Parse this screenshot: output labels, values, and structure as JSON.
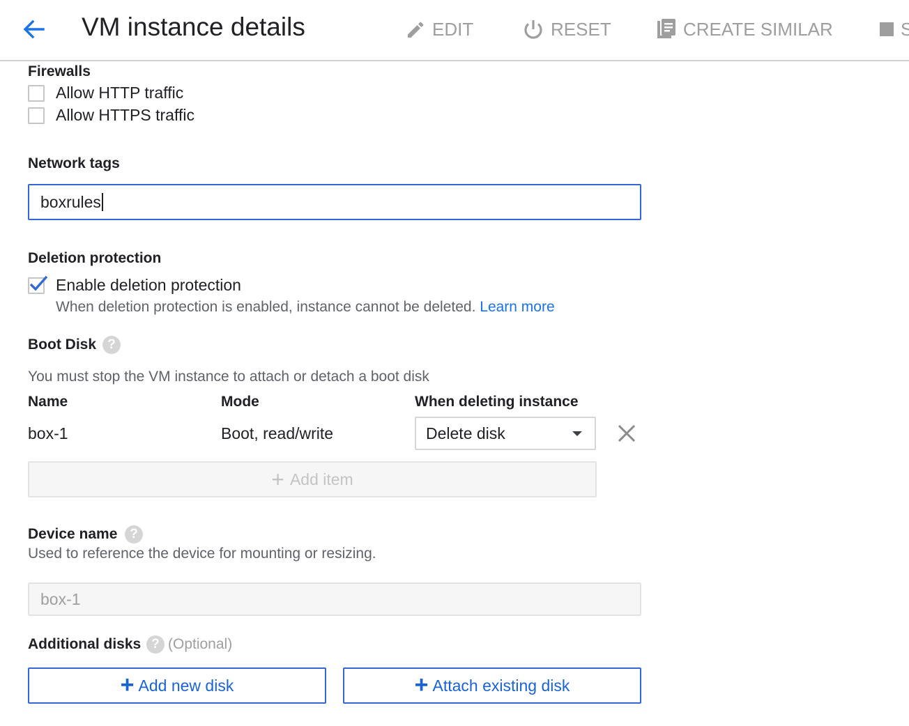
{
  "header": {
    "title": "VM instance details",
    "actions": [
      {
        "label": "EDIT",
        "icon": "pencil-icon"
      },
      {
        "label": "RESET",
        "icon": "power-icon"
      },
      {
        "label": "CREATE SIMILAR",
        "icon": "clipboard-copy-icon"
      },
      {
        "label": "S",
        "icon": "stop-icon"
      }
    ]
  },
  "firewalls": {
    "title": "Firewalls",
    "options": [
      {
        "label": "Allow HTTP traffic",
        "checked": false
      },
      {
        "label": "Allow HTTPS traffic",
        "checked": false
      }
    ]
  },
  "network_tags": {
    "title": "Network tags",
    "value": "boxrules"
  },
  "deletion_protection": {
    "title": "Deletion protection",
    "checkbox_label": "Enable deletion protection",
    "checked": true,
    "description": "When deletion protection is enabled, instance cannot be deleted.",
    "learn_more": "Learn more"
  },
  "boot_disk": {
    "title": "Boot Disk",
    "note": "You must stop the VM instance to attach or detach a boot disk",
    "columns": {
      "name": "Name",
      "mode": "Mode",
      "when_deleting": "When deleting instance"
    },
    "row": {
      "name": "box-1",
      "mode": "Boot, read/write",
      "when_deleting": "Delete disk"
    },
    "add_item": "Add item"
  },
  "device_name": {
    "title": "Device name",
    "description": "Used to reference the device for mounting or resizing.",
    "value": "box-1"
  },
  "additional_disks": {
    "title": "Additional disks",
    "optional": "(Optional)",
    "add_new": "Add new disk",
    "attach_existing": "Attach existing disk"
  },
  "colors": {
    "accent": "#1a73e8",
    "check": "#3367d6",
    "muted": "#9e9e9e"
  }
}
